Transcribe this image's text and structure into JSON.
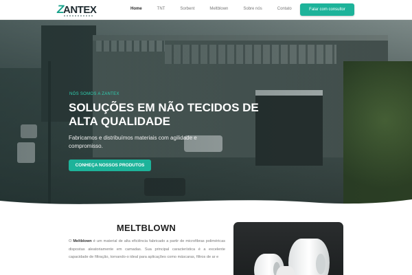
{
  "header": {
    "logo_text": "ANTEX",
    "logo_mark": "Z",
    "nav": [
      {
        "label": "Home",
        "active": true
      },
      {
        "label": "TNT",
        "active": false
      },
      {
        "label": "Sorbent",
        "active": false
      },
      {
        "label": "Meltblown",
        "active": false
      },
      {
        "label": "Sobre nós",
        "active": false
      },
      {
        "label": "Contato",
        "active": false
      }
    ],
    "cta_label": "Falar com consultor",
    "accent": "#1db39a"
  },
  "hero": {
    "eyebrow": "NÓS SOMOS A ZANTEX",
    "title": "SOLUÇÕES EM NÃO TECIDOS DE ALTA QUALIDADE",
    "subtitle": "Fabricamos e distribuímos materiais com agilidade e compromisso.",
    "button_label": "CONHEÇA NOSSOS PRODUTOS",
    "image": "factory-building-photo"
  },
  "section": {
    "title": "MELTBLOWN",
    "paragraph_intro": "O ",
    "paragraph_bold": "Meltblown",
    "paragraph_rest": " é um material de alta eficiência fabricado a partir de microfibras poliméricas dispostas aleatoriamente em camadas. Sua principal característica é a excelente capacidade de filtração, tornando-o ideal para aplicações como máscaras, filtros de ar e",
    "image": "meltblown-rolls-photo"
  }
}
